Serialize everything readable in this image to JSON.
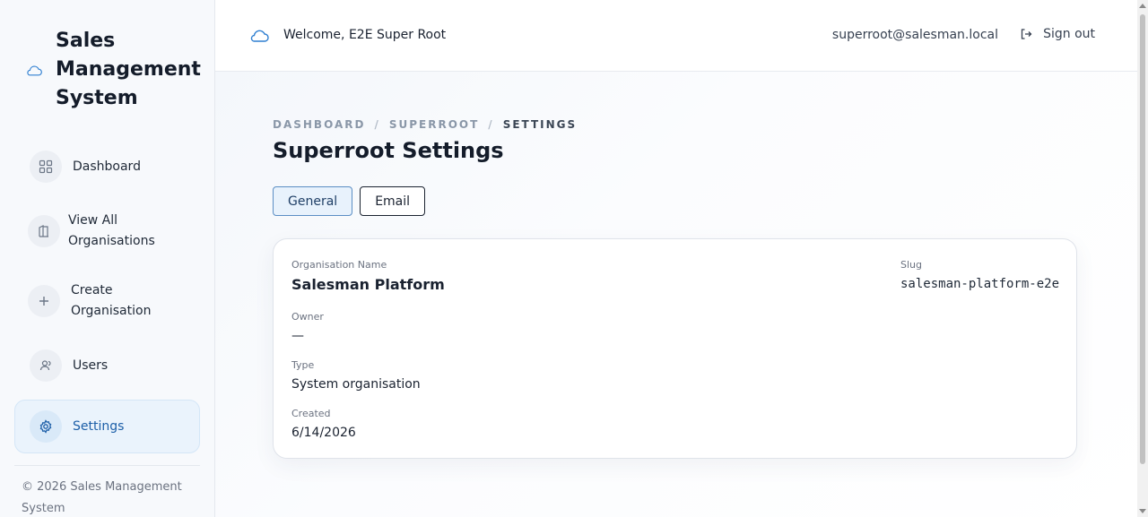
{
  "brand": {
    "title": "Sales Management System",
    "icon": "cloud-icon"
  },
  "sidebar": {
    "items": [
      {
        "label": "Dashboard",
        "icon": "grid-icon",
        "active": false
      },
      {
        "label": "View All Organisations",
        "icon": "columns-icon",
        "active": false
      },
      {
        "label": "Create Organisation",
        "icon": "plus-icon",
        "active": false
      },
      {
        "label": "Users",
        "icon": "user-icon",
        "active": false
      },
      {
        "label": "Settings",
        "icon": "gear-icon",
        "active": true
      }
    ],
    "copyright": "© 2026 Sales Management System"
  },
  "topbar": {
    "welcome": "Welcome, E2E Super Root",
    "email": "superroot@salesman.local",
    "signout_label": "Sign out"
  },
  "breadcrumb": {
    "items": [
      "DASHBOARD",
      "SUPERROOT",
      "SETTINGS"
    ],
    "separator": "/"
  },
  "page": {
    "title": "Superroot Settings"
  },
  "tabs": [
    {
      "label": "General",
      "active": true
    },
    {
      "label": "Email",
      "active": false
    }
  ],
  "details": {
    "org_name_label": "Organisation Name",
    "org_name_value": "Salesman Platform",
    "slug_label": "Slug",
    "slug_value": "salesman-platform-e2e",
    "owner_label": "Owner",
    "owner_value": "—",
    "type_label": "Type",
    "type_value": "System organisation",
    "created_label": "Created",
    "created_value": "6/14/2026"
  },
  "colors": {
    "accent": "#1d5fa8",
    "active_bg": "#eaf3fc",
    "text": "#1a2230",
    "muted": "#6b7280"
  }
}
